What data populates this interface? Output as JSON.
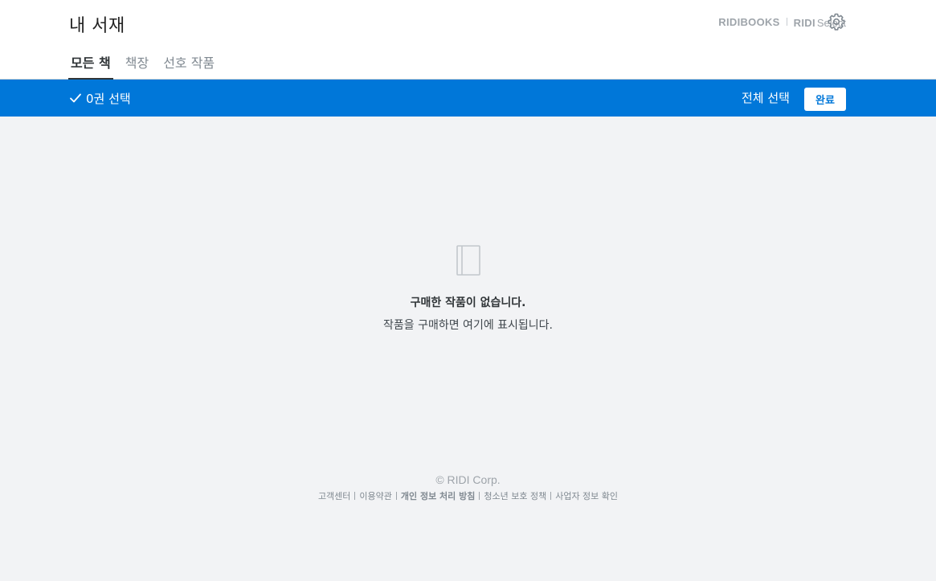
{
  "header": {
    "title": "내 서재",
    "brand": {
      "ridibooks": "RIDIBOOKS",
      "ridi": "RIDI",
      "select": "Select"
    },
    "settings_icon": "gear-icon"
  },
  "tabs": [
    {
      "label": "모든 책",
      "active": true
    },
    {
      "label": "책장",
      "active": false
    },
    {
      "label": "선호 작품",
      "active": false
    }
  ],
  "selection_bar": {
    "count_label": "0권 선택",
    "select_all_label": "전체 선택",
    "done_label": "완료",
    "background": "#0077d9"
  },
  "empty_state": {
    "icon": "book-icon",
    "title": "구매한 작품이 없습니다.",
    "description": "작품을 구매하면 여기에 표시됩니다."
  },
  "footer": {
    "copyright": "© RIDI Corp.",
    "links": [
      {
        "label": "고객센터",
        "bold": false
      },
      {
        "label": "이용약관",
        "bold": false
      },
      {
        "label": "개인 정보 처리 방침",
        "bold": true
      },
      {
        "label": "청소년 보호 정책",
        "bold": false
      },
      {
        "label": "사업자 정보 확인",
        "bold": false
      }
    ]
  }
}
